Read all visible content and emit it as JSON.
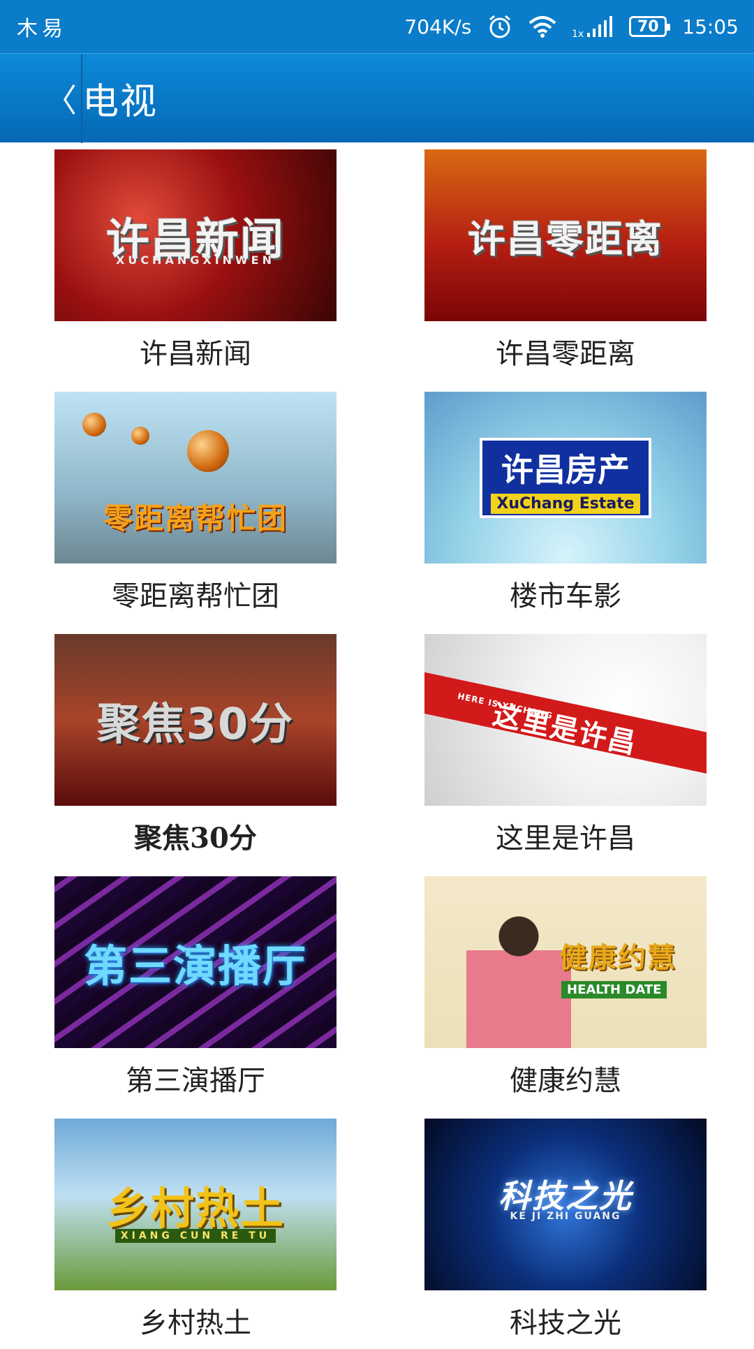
{
  "status_bar": {
    "carrier": "木易",
    "speed": "704K/s",
    "battery": "70",
    "time": "15:05",
    "network_label": "1x"
  },
  "header": {
    "back_glyph": "〈",
    "title": "电视"
  },
  "programs": [
    {
      "caption": "许昌新闻",
      "thumb_title": "许昌新闻",
      "thumb_sub": "XUCHANGXINWEN"
    },
    {
      "caption": "许昌零距离",
      "thumb_title": "许昌零距离",
      "thumb_sub": ""
    },
    {
      "caption": "零距离帮忙团",
      "thumb_title": "零距离帮忙团",
      "thumb_sub": ""
    },
    {
      "caption": "楼市车影",
      "thumb_title": "许昌房产",
      "thumb_sub": "XuChang Estate"
    },
    {
      "caption": "聚焦30分",
      "thumb_title": "聚焦30分",
      "thumb_sub": ""
    },
    {
      "caption": "这里是许昌",
      "thumb_title": "这里是许昌",
      "thumb_sub": "HERE IS XUCHANG"
    },
    {
      "caption": "第三演播厅",
      "thumb_title": "第三演播厅",
      "thumb_sub": ""
    },
    {
      "caption": "健康约慧",
      "thumb_title": "健康约慧",
      "thumb_sub": "HEALTH DATE"
    },
    {
      "caption": "乡村热土",
      "thumb_title": "乡村热土",
      "thumb_sub": "XIANG CUN RE TU"
    },
    {
      "caption": "科技之光",
      "thumb_title": "科技之光",
      "thumb_sub": "KE JI ZHI GUANG"
    }
  ]
}
